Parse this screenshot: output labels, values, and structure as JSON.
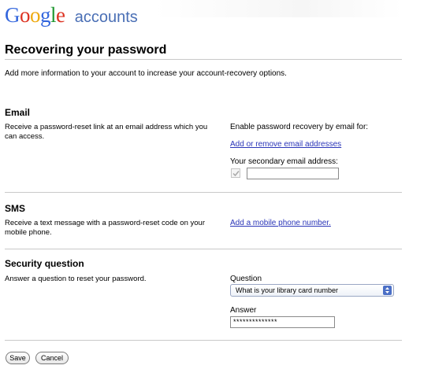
{
  "header": {
    "logo_letters": [
      {
        "ch": "G",
        "color": "#3366dd"
      },
      {
        "ch": "o",
        "color": "#dd3322"
      },
      {
        "ch": "o",
        "color": "#eeaa11"
      },
      {
        "ch": "g",
        "color": "#3366dd"
      },
      {
        "ch": "l",
        "color": "#229933"
      },
      {
        "ch": "e",
        "color": "#dd3322"
      }
    ],
    "logo_suffix": "accounts"
  },
  "page": {
    "title": "Recovering your password",
    "intro": "Add more information to your account to increase your account-recovery options."
  },
  "email_section": {
    "heading": "Email",
    "description": "Receive a password-reset link at an email address which you can access.",
    "enable_label": "Enable password recovery by email for:",
    "manage_link": "Add or remove email addresses",
    "secondary_label": "Your secondary email address:",
    "secondary_value": "",
    "checkbox_checked": true
  },
  "sms_section": {
    "heading": "SMS",
    "description": "Receive a text message with a password-reset code on your mobile phone.",
    "add_phone_link": "Add a mobile phone number."
  },
  "security_section": {
    "heading": "Security question",
    "description": "Answer a question to reset your password.",
    "question_label": "Question",
    "question_selected": "What is your library card number",
    "answer_label": "Answer",
    "answer_value": "**************"
  },
  "actions": {
    "save_label": "Save",
    "cancel_label": "Cancel"
  },
  "colors": {
    "link": "#2a35b8",
    "accounts_text": "#4a6fb5",
    "select_arrow": "#4b6fc6"
  }
}
